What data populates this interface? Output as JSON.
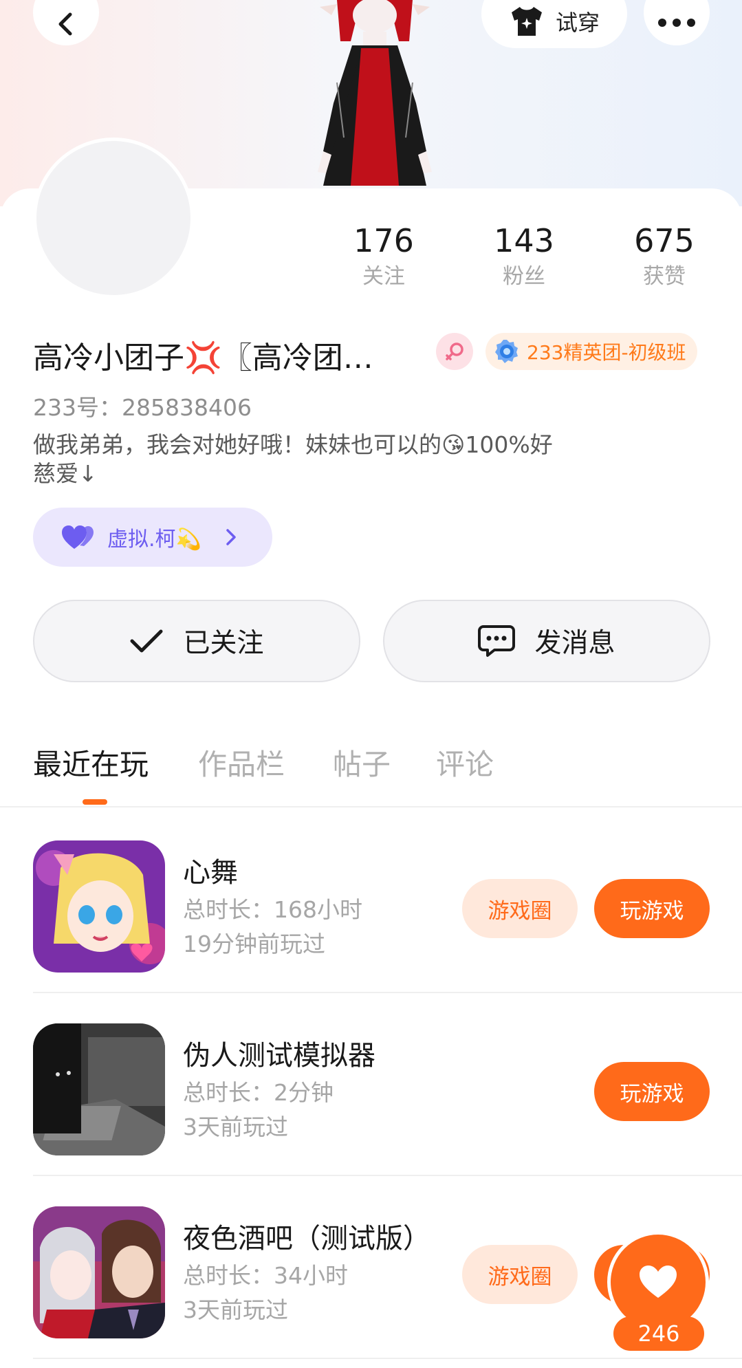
{
  "header": {
    "back_icon": "chevron-left-icon",
    "try_on_label": "试穿",
    "try_on_icon": "tshirt-icon",
    "more_icon": "more-dots-icon"
  },
  "profile": {
    "stats": [
      {
        "value": "176",
        "label": "关注"
      },
      {
        "value": "143",
        "label": "粉丝"
      },
      {
        "value": "675",
        "label": "获赞"
      }
    ],
    "name": "高冷小团子💢〖高冷团…",
    "gender_icon": "female-icon",
    "level_badge": "233精英团-初级班",
    "uid": "233号：285838406",
    "bio": "做我弟弟，我会对她好哦！妹妹也可以的😘100%好\n慈爱↓",
    "fan_group": "虚拟.柯💫"
  },
  "actions": {
    "followed_label": "已关注",
    "message_label": "发消息"
  },
  "tabs": [
    "最近在玩",
    "作品栏",
    "帖子",
    "评论"
  ],
  "active_tab": 0,
  "games": [
    {
      "title": "心舞",
      "duration": "总时长：168小时",
      "last_played": "19分钟前玩过",
      "circle_label": "游戏圈",
      "play_label": "玩游戏"
    },
    {
      "title": "伪人测试模拟器",
      "duration": "总时长：2分钟",
      "last_played": "3天前玩过",
      "circle_label": "",
      "play_label": "玩游戏"
    },
    {
      "title": "夜色酒吧（测试版）",
      "duration": "总时长：34小时",
      "last_played": "3天前玩过",
      "circle_label": "游戏圈",
      "play_label": "玩游戏"
    }
  ],
  "like_fab": {
    "icon": "heart-icon",
    "count": "246"
  },
  "colors": {
    "accent": "#ff6a1a",
    "accent_soft": "#ffe8db",
    "fan_pill_bg": "#ebe7fd",
    "fan_pill_text": "#6d5df0"
  }
}
